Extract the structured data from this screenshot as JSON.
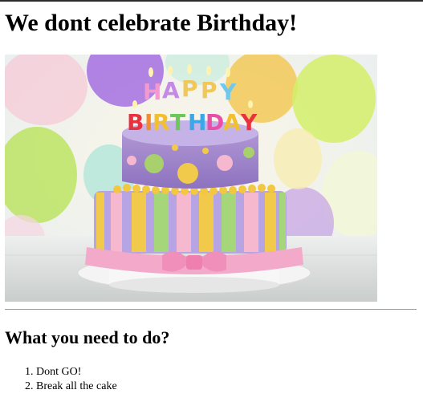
{
  "page": {
    "heading": "We dont celebrate Birthday!",
    "subheading": "What you need to do?"
  },
  "image": {
    "description_icon": "birthday-cake-image",
    "candle_text": [
      "HAPPY",
      "BIRTHDAY"
    ]
  },
  "steps": [
    "Dont GO!",
    "Break all the cake"
  ],
  "colors": {
    "text": "#000000",
    "divider": "#9a9a9a",
    "top_border": "#2b2b2b"
  }
}
